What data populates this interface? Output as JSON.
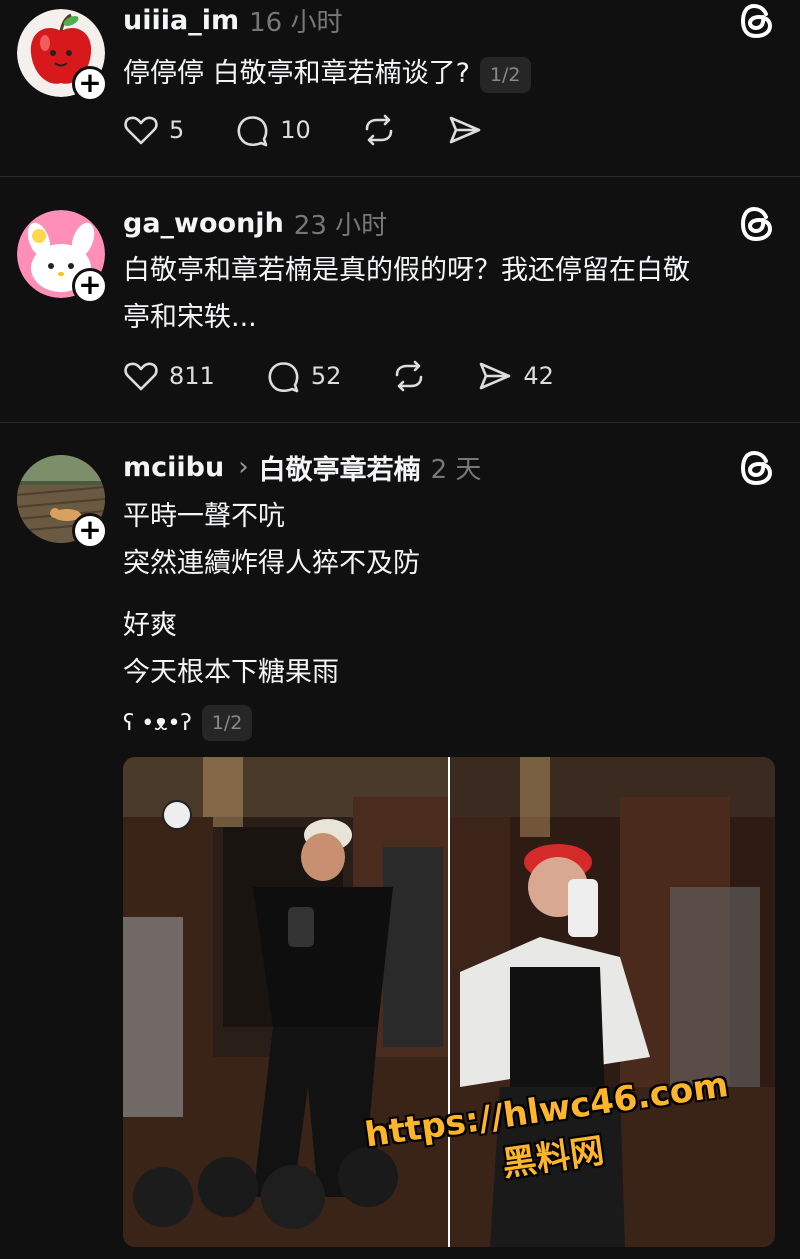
{
  "posts": [
    {
      "username": "uiiia_im",
      "time": "16 小时",
      "text": "停停停 白敬亭和章若楠谈了?",
      "pager": "1/2",
      "likes": "5",
      "replies": "10",
      "reposts": "",
      "shares": ""
    },
    {
      "username": "ga_woonjh",
      "time": "23 小时",
      "text_line1": "白敬亭和章若楠是真的假的呀？我还停留在白敬",
      "text_line2": "亭和宋轶...",
      "likes": "811",
      "replies": "52",
      "reposts": "",
      "shares": "42"
    },
    {
      "username": "mciibu",
      "topic": "白敬亭章若楠",
      "time": "2 天",
      "line1": "平時一聲不吭",
      "line2": "突然連續炸得人猝不及防",
      "line3": "好爽",
      "line4": "今天根本下糖果雨",
      "line5": "ʕ •ᴥ•ʔ",
      "pager": "1/2"
    }
  ],
  "watermark": {
    "url": "https://hlwc46.com",
    "site": "黑料网"
  },
  "colors": {
    "background": "#101010",
    "secondary_text": "#777777",
    "watermark": "#ffb52a"
  },
  "icons": [
    "threads-logo-icon",
    "heart-icon",
    "comment-icon",
    "repost-icon",
    "send-icon",
    "plus-icon",
    "chevron-right-icon"
  ]
}
